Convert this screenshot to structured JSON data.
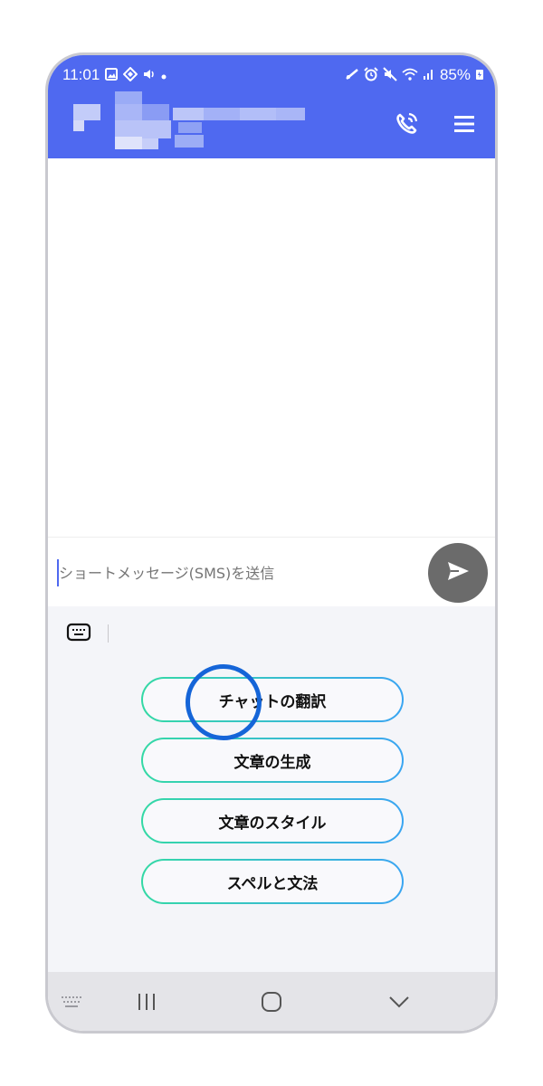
{
  "status_bar": {
    "time": "11:01",
    "battery": "85%",
    "left_icons": [
      "image-icon",
      "nfc-icon",
      "speaker-icon",
      "dot-icon"
    ],
    "right_icons": [
      "wifi-call-icon",
      "alarm-icon",
      "mute-icon",
      "wifi-icon",
      "signal-icon",
      "battery-icon"
    ]
  },
  "app_bar": {
    "title_pixelated": true,
    "call_icon": "phone-call-icon",
    "menu_icon": "hamburger-menu-icon",
    "accent": "#4f69f0"
  },
  "composer": {
    "placeholder": "ショートメッセージ(SMS)を送信",
    "send_icon": "send-arrow-icon"
  },
  "keyboard": {
    "toggle_icon": "keyboard-icon",
    "options": [
      {
        "label": "チャットの翻訳"
      },
      {
        "label": "文章の生成"
      },
      {
        "label": "文章のスタイル"
      },
      {
        "label": "スペルと文法"
      }
    ]
  },
  "nav_bar": {
    "icons": [
      "keyboard-grid-icon",
      "recent-apps-icon",
      "home-icon",
      "back-chevron-icon"
    ]
  },
  "colors": {
    "status_bar": "#4f69f0",
    "pill_gradient_start": "#34d9a5",
    "pill_gradient_end": "#3aa5f2",
    "highlight_ring": "#1565d8"
  }
}
